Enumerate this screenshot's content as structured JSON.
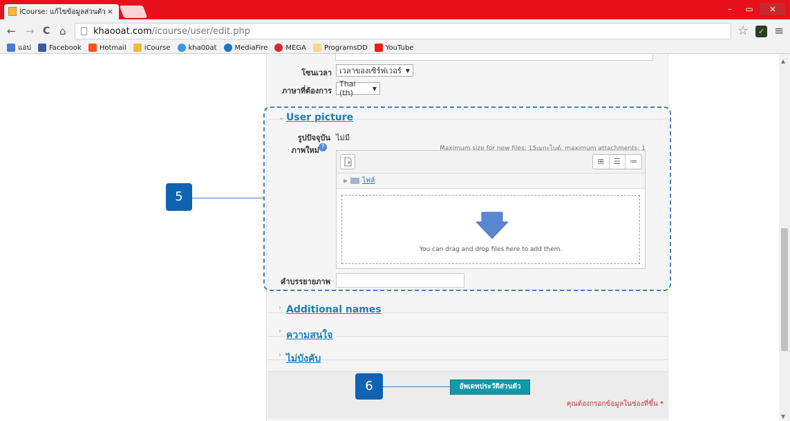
{
  "browser": {
    "tab_title": "iCourse: แก้ไขข้อมูลส่วนตัว",
    "tab_close": "×",
    "window_controls": {
      "minimize": "–",
      "maximize": "▭",
      "close": "×"
    },
    "nav": {
      "back": "←",
      "forward": "→",
      "reload": "C",
      "home": "⌂"
    },
    "url_host": "khaooat.com",
    "url_path": "/icourse/user/edit.php",
    "star": "☆",
    "menu": "≡",
    "bookmarks": [
      {
        "label": "แอป",
        "icon": "apps-icon",
        "color": "#4a7bd0"
      },
      {
        "label": "Facebook",
        "icon": "facebook-icon",
        "color": "#3b5998"
      },
      {
        "label": "Hotmail",
        "icon": "hotmail-icon",
        "color": "#f35325"
      },
      {
        "label": "iCourse",
        "icon": "icourse-icon",
        "color": "#f6b73c"
      },
      {
        "label": "kha00at",
        "icon": "kha00at-icon",
        "color": "#3a9ad9"
      },
      {
        "label": "MediaFire",
        "icon": "mediafire-icon",
        "color": "#1877c9"
      },
      {
        "label": "MEGA",
        "icon": "mega-icon",
        "color": "#d9272e"
      },
      {
        "label": "ProgramsDD",
        "icon": "folder-icon",
        "color": "#f3d98a"
      },
      {
        "label": "YouTube",
        "icon": "youtube-icon",
        "color": "#e62117"
      }
    ]
  },
  "form": {
    "timezone_label": "โซนเวลา",
    "timezone_value": "เวลาของเซิร์ฟเวอร์",
    "language_label": "ภาษาที่ต้องการ",
    "language_value": "Thai (th)",
    "user_picture": {
      "heading": "User picture",
      "current_label": "รูปปัจจุบัน",
      "current_value": "ไม่มี",
      "new_label": "ภาพใหม่",
      "max_size_text": "Maximum size for new files: 15เมกะไบต์, maximum attachments: 1",
      "folder_label": "ไฟล์",
      "drop_text": "You can drag and drop files here to add them.",
      "description_label": "คำบรรยายภาพ",
      "description_value": ""
    },
    "sections": [
      {
        "label": "Additional names"
      },
      {
        "label": "ความสนใจ"
      },
      {
        "label": "ไม่บังคับ"
      }
    ],
    "submit_label": "อัพเดทประวัติส่วนตัว",
    "required_note": "คุณต้องกรอกข้อมูลในช่องที่ขึ้น",
    "required_star": "*"
  },
  "callouts": {
    "five": "5",
    "six": "6"
  }
}
